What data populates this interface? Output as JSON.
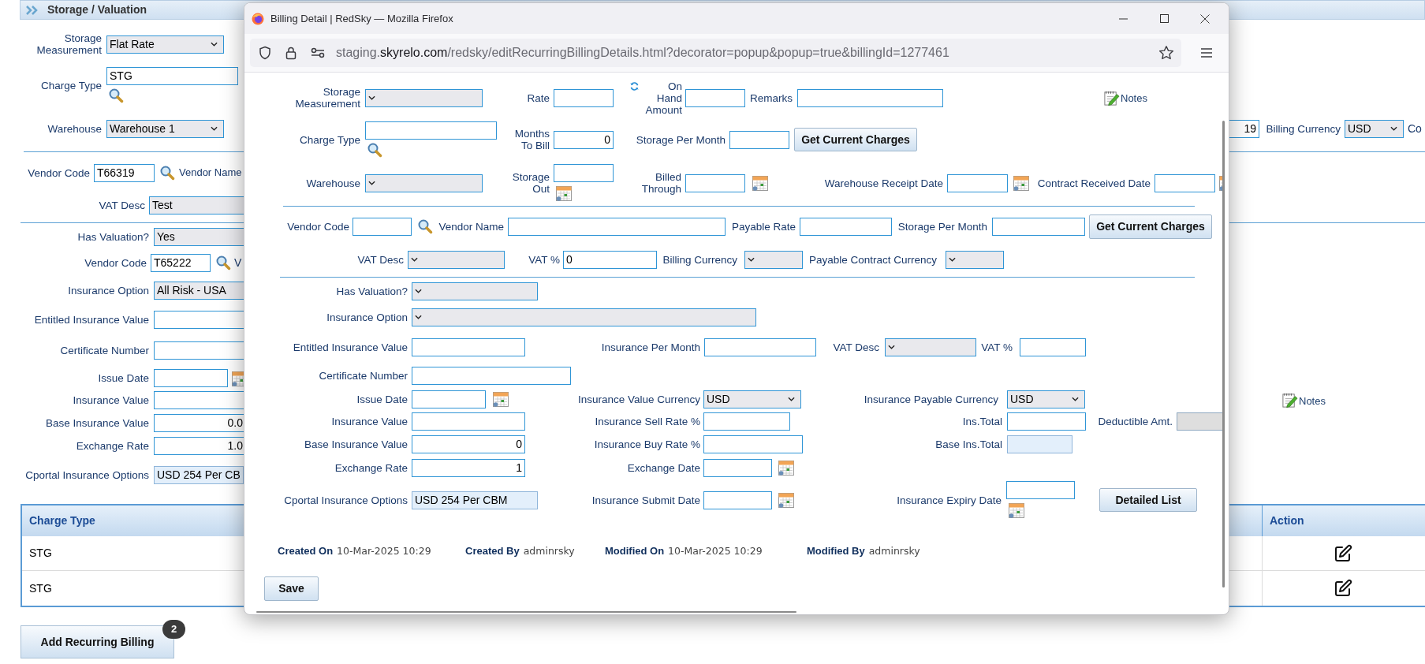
{
  "page": {
    "section_title": "Storage / Valuation",
    "sections": [
      [
        [
          {
            "kind": "select",
            "label": "Storage Measurement",
            "value": "Flat Rate"
          }
        ],
        [
          {
            "kind": "lookup",
            "label": "Charge Type",
            "value": "STG"
          }
        ],
        [
          {
            "kind": "select",
            "label": "Warehouse",
            "value": "Warehouse 1"
          },
          {
            "kind": "input",
            "value": "19"
          },
          {
            "kind": "select",
            "label": "Billing Currency",
            "value": "USD"
          },
          {
            "kind": "text",
            "label": "Co"
          }
        ]
      ],
      [
        [
          {
            "kind": "lookup",
            "label": "Vendor Code",
            "value": "T66319"
          },
          {
            "kind": "text",
            "label": "Vendor Name"
          }
        ],
        [
          {
            "kind": "select",
            "label": "VAT Desc",
            "value": "Test"
          }
        ]
      ],
      [
        [
          {
            "kind": "select",
            "label": "Has Valuation?",
            "value": "Yes"
          }
        ],
        [
          {
            "kind": "lookup",
            "label": "Vendor Code",
            "value": "T65222"
          },
          {
            "kind": "text",
            "label": "V"
          }
        ],
        [
          {
            "kind": "select",
            "label": "Insurance Option",
            "value": "All Risk - USA"
          }
        ],
        [
          {
            "kind": "input",
            "label": "Entitled Insurance Value"
          }
        ],
        [
          {
            "kind": "input",
            "label": "Certificate Number"
          }
        ],
        [
          {
            "kind": "date",
            "label": "Issue Date"
          }
        ],
        [
          {
            "kind": "input",
            "label": "Insurance Value"
          },
          {
            "kind": "notes",
            "label": "Notes"
          }
        ],
        [
          {
            "kind": "input",
            "label": "Base Insurance Value",
            "value": "0.0"
          }
        ],
        [
          {
            "kind": "input",
            "label": "Exchange Rate",
            "value": "1.0"
          }
        ],
        [
          {
            "kind": "readonly",
            "label": "Cportal Insurance Options",
            "value": "USD 254 Per CB"
          }
        ]
      ]
    ],
    "table": {
      "columns": [
        "Charge Type",
        "Action"
      ],
      "rows": [
        [
          "STG"
        ],
        [
          "STG"
        ]
      ]
    },
    "add_button": {
      "label": "Add Recurring Billing",
      "badge": "2"
    }
  },
  "popup": {
    "title": "Billing Detail | RedSky — Mozilla Firefox",
    "url": {
      "prefix": "staging.",
      "domain": "skyrelo.com",
      "path": "/redsky/editRecurringBillingDetails.html?decorator=popup&popup=true&billingId=1277461"
    },
    "sections": [
      [
        [
          {
            "kind": "select",
            "label": "Storage Measurement"
          },
          {
            "kind": "input",
            "label": "Rate"
          },
          {
            "kind": "input",
            "label": "On Hand Amount"
          },
          {
            "kind": "input",
            "label": "Remarks"
          },
          {
            "kind": "notes",
            "label": "Notes"
          }
        ],
        [
          {
            "kind": "lookup",
            "label": "Charge Type"
          },
          {
            "kind": "input",
            "label": "Months To Bill",
            "value": "0"
          },
          {
            "kind": "input",
            "label": "Storage Per Month"
          },
          {
            "kind": "button",
            "label": "Get Current Charges"
          }
        ],
        [
          {
            "kind": "select",
            "label": "Warehouse"
          },
          {
            "kind": "date",
            "label": "Storage Out"
          },
          {
            "kind": "date",
            "label": "Billed Through"
          },
          {
            "kind": "date",
            "label": "Warehouse Receipt Date"
          },
          {
            "kind": "date",
            "label": "Contract Received Date"
          }
        ]
      ],
      [
        [
          {
            "kind": "lookup",
            "label": "Vendor Code"
          },
          {
            "kind": "input",
            "label": "Vendor Name"
          },
          {
            "kind": "input",
            "label": "Payable Rate"
          },
          {
            "kind": "input",
            "label": "Storage Per Month"
          },
          {
            "kind": "button",
            "label": "Get Current Charges"
          }
        ],
        [
          {
            "kind": "select",
            "label": "VAT Desc"
          },
          {
            "kind": "input",
            "label": "VAT %",
            "value": "0"
          },
          {
            "kind": "select",
            "label": "Billing Currency"
          },
          {
            "kind": "select",
            "label": "Payable Contract Currency"
          }
        ]
      ],
      [
        [
          {
            "kind": "select",
            "label": "Has Valuation?"
          }
        ],
        [
          {
            "kind": "select",
            "label": "Insurance Option"
          }
        ],
        [
          {
            "kind": "input",
            "label": "Entitled Insurance Value"
          },
          {
            "kind": "input",
            "label": "Insurance Per Month"
          },
          {
            "kind": "select",
            "label": "VAT Desc"
          },
          {
            "kind": "input",
            "label": "VAT %"
          }
        ],
        [
          {
            "kind": "input",
            "label": "Certificate Number"
          }
        ],
        [
          {
            "kind": "date",
            "label": "Issue Date"
          },
          {
            "kind": "select",
            "label": "Insurance Value Currency",
            "value": "USD"
          },
          {
            "kind": "select",
            "label": "Insurance Payable Currency",
            "value": "USD"
          }
        ],
        [
          {
            "kind": "input",
            "label": "Insurance Value"
          },
          {
            "kind": "input",
            "label": "Insurance Sell Rate %"
          },
          {
            "kind": "input",
            "label": "Ins.Total"
          },
          {
            "kind": "disabled",
            "label": "Deductible Amt."
          }
        ],
        [
          {
            "kind": "input",
            "label": "Base Insurance Value",
            "value": "0"
          },
          {
            "kind": "input",
            "label": "Insurance Buy Rate %"
          },
          {
            "kind": "readonly",
            "label": "Base Ins.Total"
          }
        ],
        [
          {
            "kind": "input",
            "label": "Exchange Rate",
            "value": "1"
          },
          {
            "kind": "date",
            "label": "Exchange Date"
          }
        ],
        [
          {
            "kind": "readonly",
            "label": "Cportal Insurance Options",
            "value": "USD 254 Per CBM"
          },
          {
            "kind": "date",
            "label": "Insurance Submit Date"
          },
          {
            "kind": "date",
            "label": "Insurance Expiry Date"
          },
          {
            "kind": "button",
            "label": "Detailed List"
          }
        ]
      ]
    ],
    "footer": [
      {
        "label": "Created On",
        "value": "10-Mar-2025 10:29"
      },
      {
        "label": "Created By",
        "value": "adminrsky"
      },
      {
        "label": "Modified On",
        "value": "10-Mar-2025 10:29"
      },
      {
        "label": "Modified By",
        "value": "adminrsky"
      }
    ],
    "save_button": "Save"
  }
}
